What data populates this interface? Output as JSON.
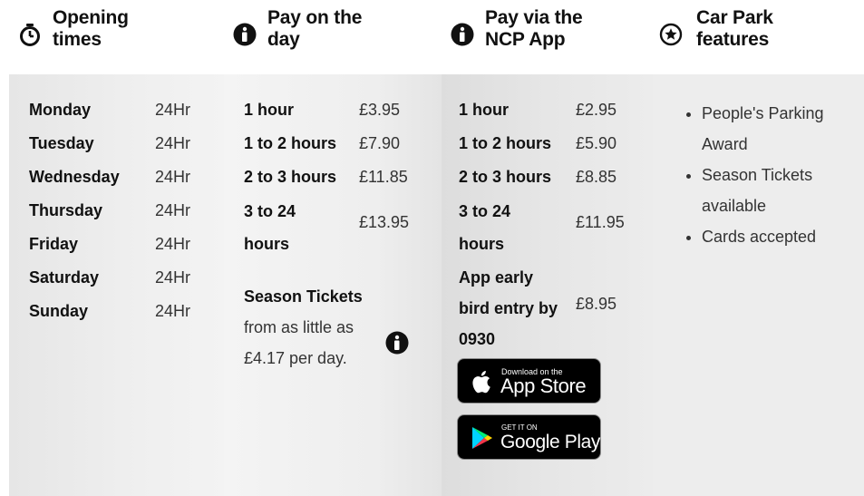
{
  "opening": {
    "title_line1": "Opening",
    "title_line2": "times",
    "icon": "stopwatch-icon",
    "days": [
      {
        "day": "Monday",
        "hours": "24Hr"
      },
      {
        "day": "Tuesday",
        "hours": "24Hr"
      },
      {
        "day": "Wednesday",
        "hours": "24Hr"
      },
      {
        "day": "Thursday",
        "hours": "24Hr"
      },
      {
        "day": "Friday",
        "hours": "24Hr"
      },
      {
        "day": "Saturday",
        "hours": "24Hr"
      },
      {
        "day": "Sunday",
        "hours": "24Hr"
      }
    ]
  },
  "pay_day": {
    "title_line1": "Pay on the",
    "title_line2": "day",
    "icon": "info-icon",
    "rates": [
      {
        "label": "1 hour",
        "price": "£3.95"
      },
      {
        "label": "1 to 2 hours",
        "price": "£7.90"
      },
      {
        "label": "2 to 3 hours",
        "price": "£11.85"
      },
      {
        "label": "3 to 24 hours",
        "price": "£13.95"
      }
    ],
    "season_bold": "Season Tickets",
    "season_text": " from as little as £4.17 per day."
  },
  "pay_app": {
    "title_line1": "Pay via the",
    "title_line2": "NCP App",
    "icon": "info-icon",
    "rates": [
      {
        "label": "1 hour",
        "price": "£2.95"
      },
      {
        "label": "1 to 2 hours",
        "price": "£5.90"
      },
      {
        "label": "2 to 3 hours",
        "price": "£8.85"
      },
      {
        "label": "3 to 24 hours",
        "price": "£11.95"
      },
      {
        "label": "App early bird entry by 0930",
        "price": "£8.95"
      }
    ],
    "appstore_small": "Download on the",
    "appstore_big": "App Store",
    "googleplay_small": "GET IT ON",
    "googleplay_big": "Google Play"
  },
  "features": {
    "title_line1": "Car Park",
    "title_line2": "features",
    "icon": "star-circle-icon",
    "items": [
      "People's Parking Award",
      "Season Tickets available",
      "Cards accepted"
    ]
  }
}
